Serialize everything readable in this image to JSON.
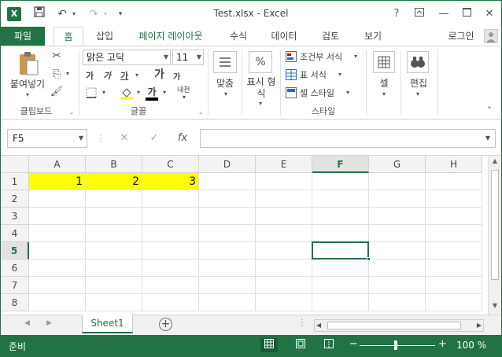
{
  "window": {
    "title": "Test.xlsx - Excel",
    "app_icon": "X",
    "help": "?",
    "accent": "#217346"
  },
  "tabs": [
    {
      "label": "파일"
    },
    {
      "label": "홈"
    },
    {
      "label": "삽입"
    },
    {
      "label": "페이지 레이아웃"
    },
    {
      "label": "수식"
    },
    {
      "label": "데이터"
    },
    {
      "label": "검토"
    },
    {
      "label": "보기"
    }
  ],
  "signin": "로그인",
  "ribbon": {
    "clipboard": {
      "paste": "붙여넣기",
      "label": "클립보드"
    },
    "font": {
      "name": "맑은 고딕",
      "size": "11",
      "label": "글꼴",
      "bold": "가",
      "italic": "가",
      "underline": "가",
      "grow": "가",
      "shrink": "가",
      "color_glyph": "가",
      "phonetic": "내천"
    },
    "align": {
      "label": "맞춤"
    },
    "number": {
      "label_line1": "표시 형",
      "label_line2": "식",
      "percent": "%"
    },
    "styles": {
      "conditional": "조건부 서식",
      "table": "표 서식",
      "cell_style": "셀 스타일",
      "label": "스타일"
    },
    "cells": {
      "label": "셀"
    },
    "editing": {
      "label": "편집"
    }
  },
  "formula_bar": {
    "name_box": "F5",
    "fx": "fx",
    "cancel": "✕",
    "enter": "✓",
    "value": ""
  },
  "grid": {
    "columns": [
      "A",
      "B",
      "C",
      "D",
      "E",
      "F",
      "G",
      "H"
    ],
    "rows": [
      "1",
      "2",
      "3",
      "4",
      "5",
      "6",
      "7",
      "8"
    ],
    "selected_col": "F",
    "selected_row": "5",
    "cells": [
      {
        "ref": "A1",
        "value": "1",
        "fill": "#ffff00"
      },
      {
        "ref": "B1",
        "value": "2",
        "fill": "#ffff00"
      },
      {
        "ref": "C1",
        "value": "3",
        "fill": "#ffff00"
      }
    ]
  },
  "sheets": {
    "active": "Sheet1",
    "add": "+"
  },
  "status": {
    "ready": "준비",
    "zoom": "100 %",
    "zoom_minus": "−",
    "zoom_plus": "+"
  }
}
